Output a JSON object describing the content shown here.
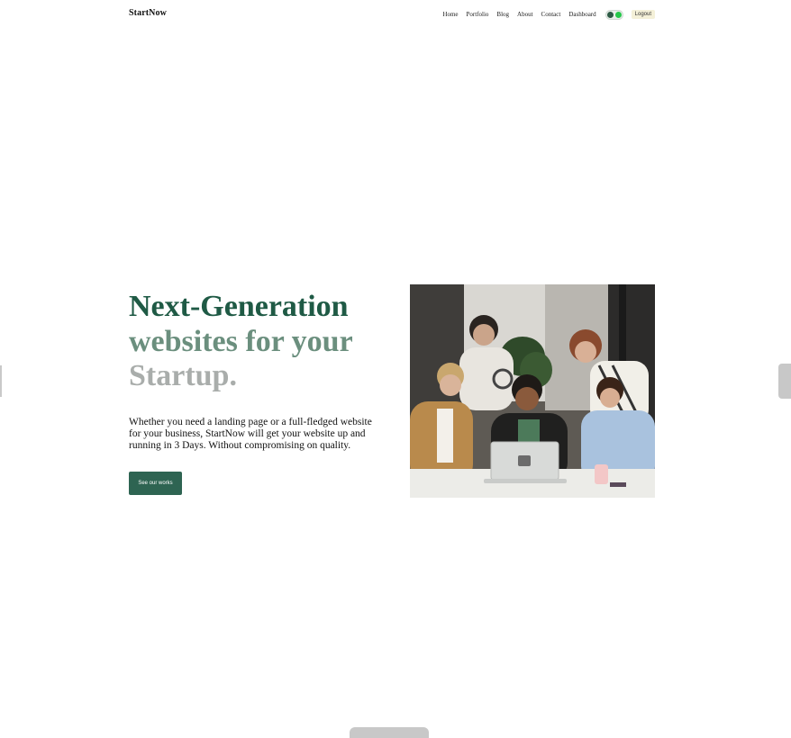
{
  "nav": {
    "brand": "StartNow",
    "links": [
      "Home",
      "Portfolio",
      "Blog",
      "About",
      "Contact",
      "Dashboard"
    ],
    "logout": "Logout",
    "theme_toggle_icon": "toggle-switch"
  },
  "hero": {
    "title_line1": "Next-Generation",
    "title_line2": "websites for your",
    "title_line3": "Startup.",
    "description": "Whether you need a landing page or a full-fledged website for your business, StartNow will get your website up and running in 3 Days. Without compromising on quality.",
    "cta_label": "See our works",
    "image_alt": "Team of young people looking at a laptop"
  },
  "colors": {
    "accent": "#2e6452",
    "title_dark": "#1f5a45",
    "title_mid": "#6b8f7e",
    "title_light": "#a9adab"
  }
}
